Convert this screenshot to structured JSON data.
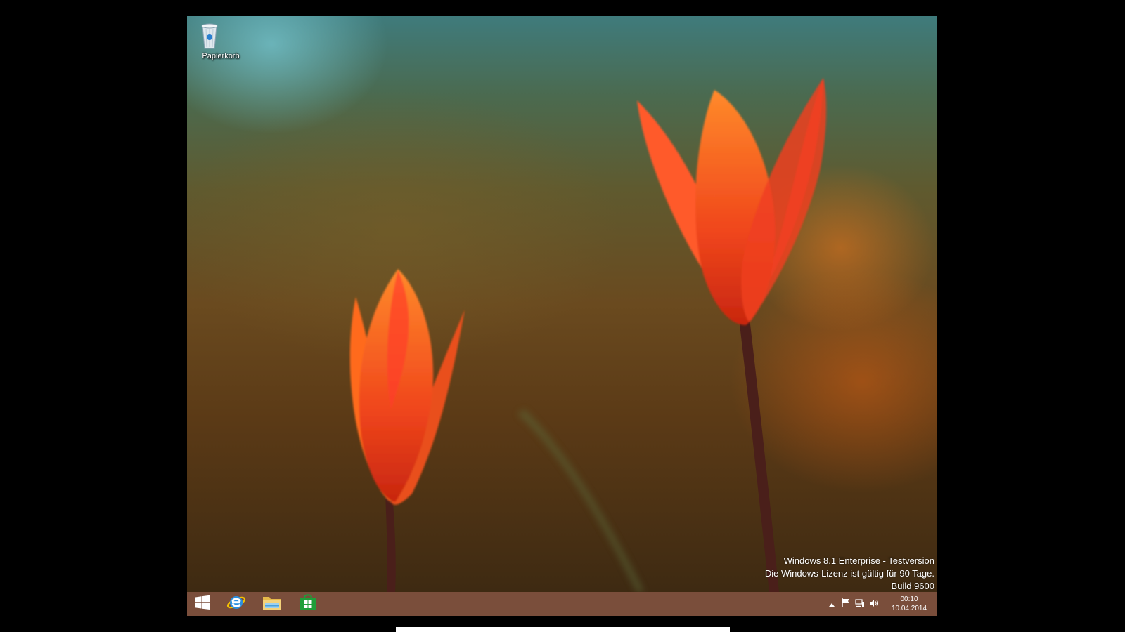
{
  "desktop": {
    "icons": [
      {
        "label": "Papierkorb",
        "icon": "recycle-bin-icon"
      }
    ]
  },
  "watermark": {
    "line1": "Windows 8.1 Enterprise - Testversion",
    "line2": "Die Windows-Lizenz ist gültig für 90 Tage.",
    "line3": "Build 9600"
  },
  "taskbar": {
    "pinned": [
      {
        "name": "start-icon"
      },
      {
        "name": "internet-explorer-icon"
      },
      {
        "name": "file-explorer-icon"
      },
      {
        "name": "windows-store-icon"
      }
    ],
    "tray": {
      "icons": [
        "show-hidden-icons",
        "action-center-flag-icon",
        "network-icon",
        "volume-icon"
      ]
    },
    "clock": {
      "time": "00:10",
      "date": "10.04.2014"
    }
  },
  "colors": {
    "taskbar": "#7a4e3b",
    "start_accent": "#ffffff",
    "store_green": "#1f9e39"
  }
}
